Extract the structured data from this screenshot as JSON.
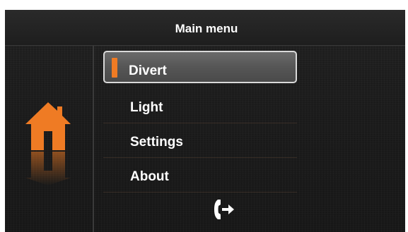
{
  "header": {
    "title": "Main menu"
  },
  "menu": {
    "items": [
      {
        "label": "Divert",
        "selected": true
      },
      {
        "label": "Light",
        "selected": false
      },
      {
        "label": "Settings",
        "selected": false
      },
      {
        "label": "About",
        "selected": false
      }
    ]
  },
  "icons": {
    "home": "home-icon",
    "exit": "exit-icon"
  },
  "colors": {
    "accent": "#ef7b24",
    "background": "#1e1e1e",
    "selection": "#5a5a5a",
    "text": "#ffffff"
  }
}
